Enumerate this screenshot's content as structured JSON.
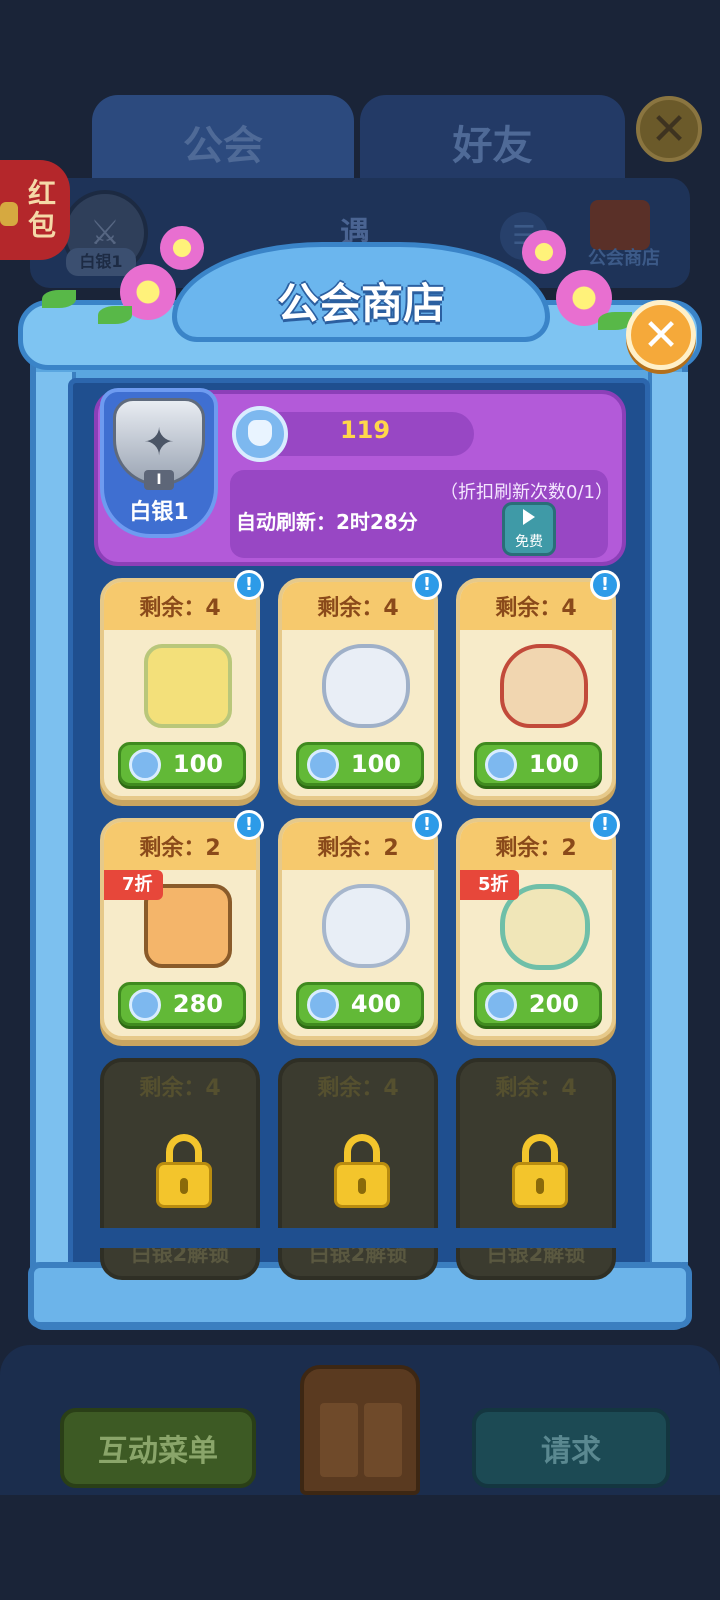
{
  "background": {
    "tabs": [
      "公会",
      "好友"
    ],
    "rank_label": "白银1",
    "encounter_text": "遇",
    "shop_label": "公会商店",
    "red_packet": "红包",
    "bottom_buttons": {
      "menu": "互动菜单",
      "request": "请求"
    }
  },
  "shop": {
    "title": "公会商店",
    "rank": {
      "numeral": "I",
      "name": "白银1"
    },
    "currency": 119,
    "refresh_count": "（折扣刷新次数0/1）",
    "auto_refresh": "自动刷新：2时28分",
    "free_button": "免费",
    "items": [
      {
        "stock": "剩余：4",
        "price": "100",
        "item": "tofu-dish-icon"
      },
      {
        "stock": "剩余：4",
        "price": "100",
        "item": "tea-cup-icon"
      },
      {
        "stock": "剩余：4",
        "price": "100",
        "item": "dumpling-plate-icon"
      },
      {
        "stock": "剩余：2",
        "price": "280",
        "item": "layer-cake-icon",
        "discount": "7折"
      },
      {
        "stock": "剩余：2",
        "price": "400",
        "item": "teapot-icon"
      },
      {
        "stock": "剩余：2",
        "price": "200",
        "item": "dumpling-soup-icon",
        "discount": "5折"
      }
    ],
    "locked_items": [
      {
        "stock": "剩余：4",
        "unlock": "白银2解锁"
      },
      {
        "stock": "剩余：4",
        "unlock": "白银2解锁"
      },
      {
        "stock": "剩余：4",
        "unlock": "白银2解锁"
      }
    ]
  }
}
